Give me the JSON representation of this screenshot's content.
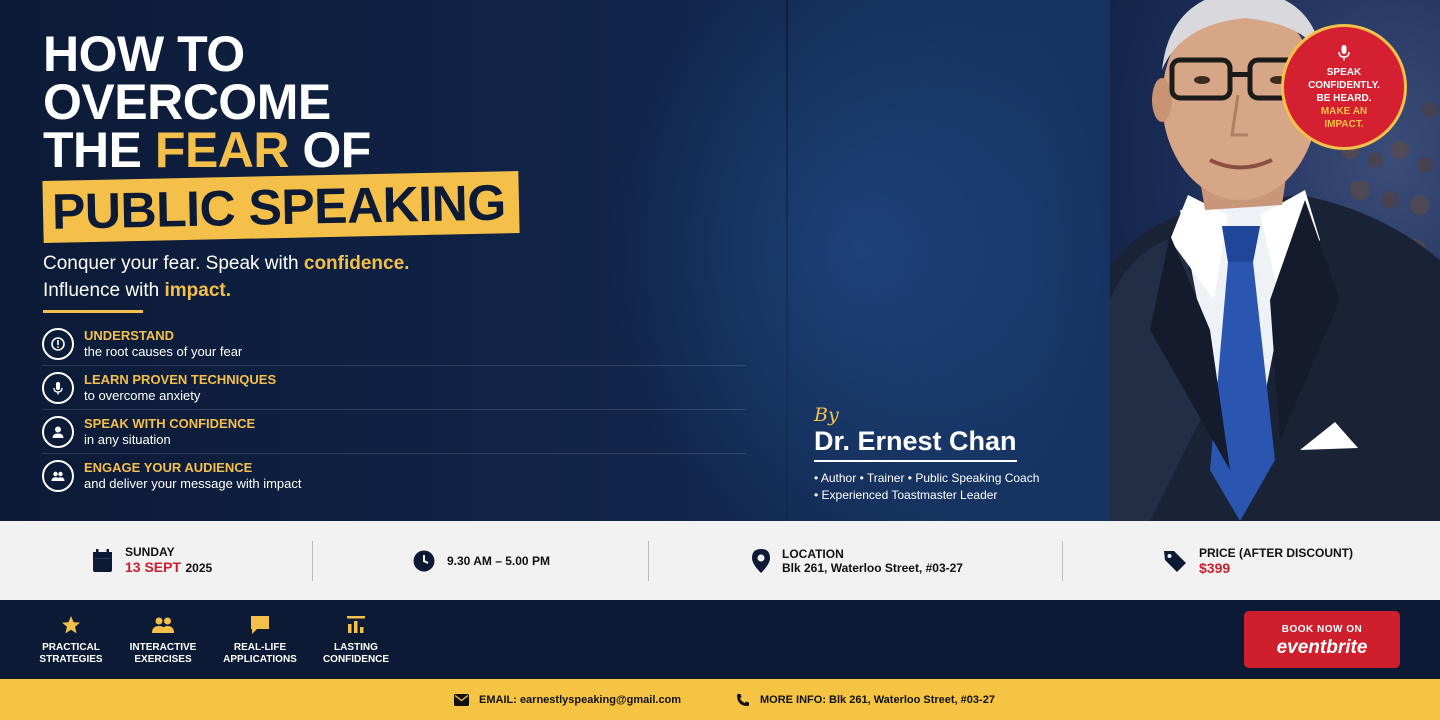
{
  "headline": {
    "line1": "HOW TO",
    "line2": "OVERCOME",
    "line3_a": "THE ",
    "line3_highlight": "FEAR",
    "line3_b": " OF",
    "line4": "PUBLIC SPEAKING"
  },
  "tagline": {
    "part1": "Conquer your fear. Speak with ",
    "part1_gold": "confidence.",
    "part2": "Influence with ",
    "part2_gold": "impact."
  },
  "benefits": [
    {
      "title": "UNDERSTAND",
      "desc": "the root causes of your fear",
      "icon": "alert-circle-icon"
    },
    {
      "title": "LEARN PROVEN TECHNIQUES",
      "desc": "to overcome anxiety",
      "icon": "microphone-icon"
    },
    {
      "title": "SPEAK WITH CONFIDENCE",
      "desc": "in any situation",
      "icon": "person-icon"
    },
    {
      "title": "ENGAGE YOUR AUDIENCE",
      "desc": "and deliver your message with impact",
      "icon": "group-icon"
    }
  ],
  "speaker": {
    "by": "By",
    "name": "Dr. Ernest Chan",
    "creds_line1": "• Author   • Trainer   • Public Speaking Coach",
    "creds_line2": "• Experienced Toastmaster Leader"
  },
  "badge": {
    "line1": "SPEAK",
    "line2": "CONFIDENTLY.",
    "line3": "BE HEARD.",
    "line4": "MAKE AN",
    "line5": "IMPACT."
  },
  "info": {
    "day_label": "SUNDAY",
    "date": "13 SEPT",
    "year": "2025",
    "time": "9.30 AM – 5.00 PM",
    "location_label": "LOCATION",
    "location": "Blk 261, Waterloo Street, #03-27",
    "price_label": "PRICE (AFTER DISCOUNT)",
    "price": "$399"
  },
  "features": [
    {
      "line1": "PRACTICAL",
      "line2": "STRATEGIES",
      "icon": "star-icon"
    },
    {
      "line1": "INTERACTIVE",
      "line2": "EXERCISES",
      "icon": "people-icon"
    },
    {
      "line1": "REAL-LIFE",
      "line2": "APPLICATIONS",
      "icon": "chat-icon"
    },
    {
      "line1": "LASTING",
      "line2": "CONFIDENCE",
      "icon": "bar-chart-icon"
    }
  ],
  "book": {
    "top": "BOOK NOW ON",
    "brand": "eventbrite"
  },
  "footer": {
    "email": "EMAIL: earnestlyspeaking@gmail.com",
    "more": "MORE INFO: Blk 261, Waterloo Street, #03-27"
  },
  "colors": {
    "navy": "#0c1a36",
    "gold": "#f4c04a",
    "red": "#cf1f2c",
    "light": "#f2f2f2"
  }
}
